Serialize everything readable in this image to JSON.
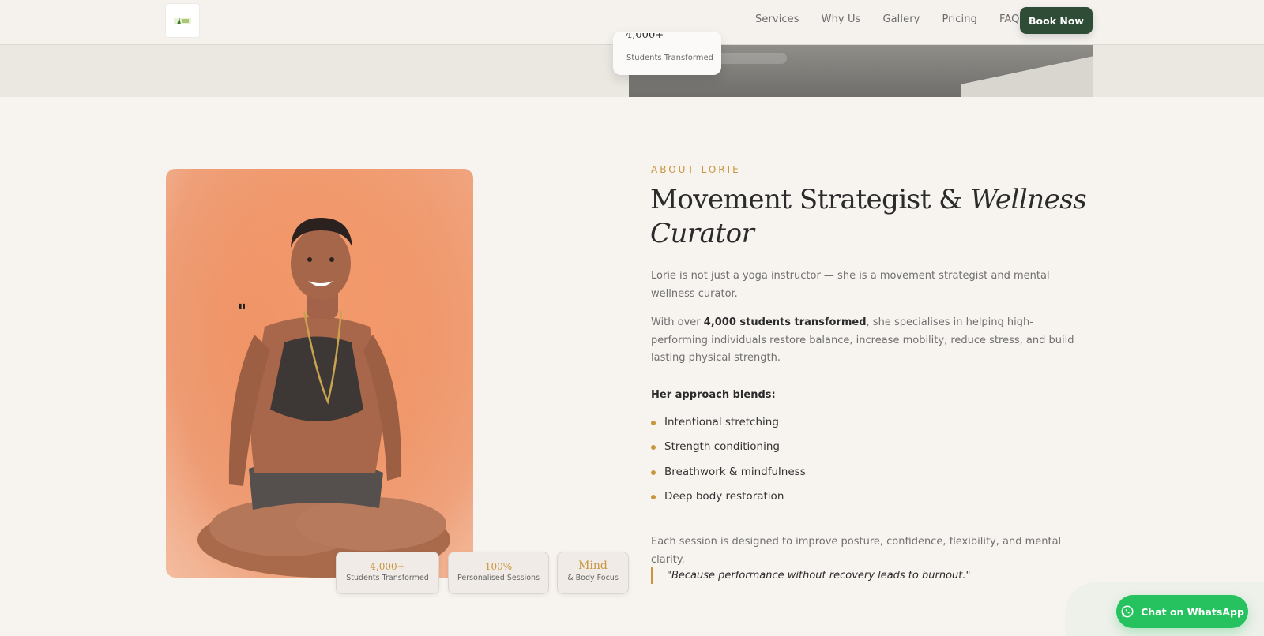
{
  "header": {
    "nav": [
      "Services",
      "Why Us",
      "Gallery",
      "Pricing",
      "FAQ"
    ],
    "cta_label": "Book Now"
  },
  "hero_card": {
    "label": "Students Transformed"
  },
  "about": {
    "eyebrow": "ABOUT LORIE",
    "heading_plain": "Movement Strategist & ",
    "heading_italic": "Wellness Curator",
    "intro": "Lorie is not just a yoga instructor — she is a movement strategist and mental wellness curator.",
    "para2_before": "With over ",
    "para2_bold": "4,000 students transformed",
    "para2_after": ", she specialises in helping high-performing individuals restore balance, increase mobility, reduce stress, and build lasting physical strength.",
    "approach_title": "Her approach blends:",
    "approach_items": [
      "Intentional stretching",
      "Strength conditioning",
      "Breathwork & mindfulness",
      "Deep body restoration"
    ],
    "session_text": "Each session is designed to improve posture, confidence, flexibility, and mental clarity.",
    "quote": "\"Because performance without recovery leads to burnout.\""
  },
  "stats": [
    {
      "value": "4,000+",
      "label": "Students Transformed"
    },
    {
      "value": "100%",
      "label": "Personalised Sessions"
    },
    {
      "value": "Mind",
      "label": "& Body Focus"
    }
  ],
  "whatsapp": {
    "label": "Chat on WhatsApp"
  },
  "colors": {
    "accent_gold": "#c8963e",
    "brand_green": "#2f4d36",
    "whatsapp_green": "#25c25f",
    "page_bg": "#f7f3ef"
  }
}
